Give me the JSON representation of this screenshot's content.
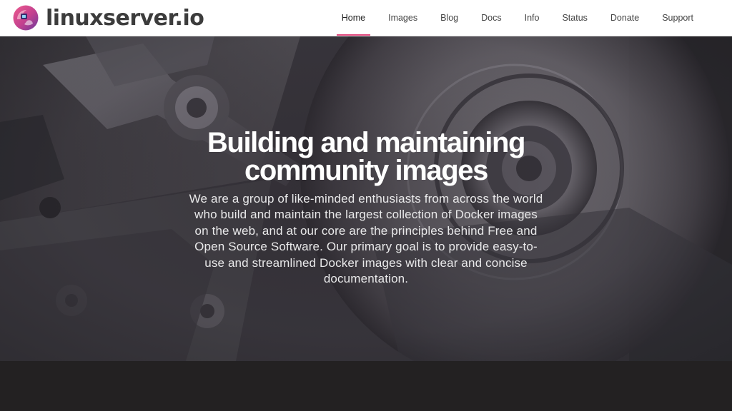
{
  "brand": {
    "name": "linuxserver.io",
    "logo_icon": "linuxserver-logo-icon"
  },
  "nav": {
    "items": [
      {
        "label": "Home",
        "active": true
      },
      {
        "label": "Images",
        "active": false
      },
      {
        "label": "Blog",
        "active": false
      },
      {
        "label": "Docs",
        "active": false
      },
      {
        "label": "Info",
        "active": false
      },
      {
        "label": "Status",
        "active": false
      },
      {
        "label": "Donate",
        "active": false
      },
      {
        "label": "Support",
        "active": false
      }
    ]
  },
  "hero": {
    "title": "Building and maintaining community images",
    "description": "We are a group of like-minded enthusiasts from across the world who build and maintain the largest collection of Docker images on the web, and at our core are the principles behind Free and Open Source Software. Our primary goal is to provide easy-to-use and streamlined Docker images with clear and concise documentation.",
    "background_image": "hard-drive-platter-image"
  },
  "colors": {
    "accent": "#e0457b",
    "nav_bg": "#ffffff",
    "hero_overlay": "#2e2c30",
    "footer_band": "#232122"
  }
}
